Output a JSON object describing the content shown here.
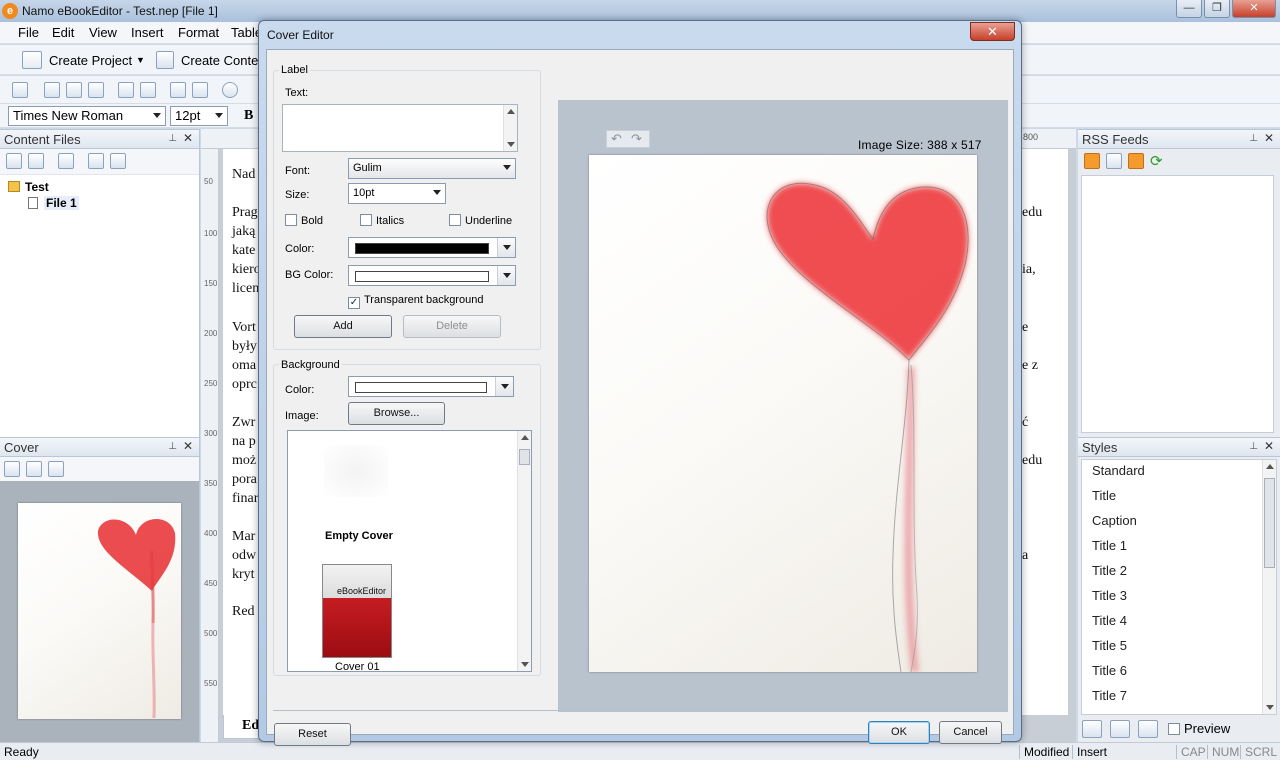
{
  "app": {
    "title": "Namo eBookEditor - Test.nep [File 1]",
    "icon_letter": "e",
    "window_buttons": [
      "—",
      "❐",
      "✕"
    ]
  },
  "menu": [
    "File",
    "Edit",
    "View",
    "Insert",
    "Format",
    "Table"
  ],
  "toolbar": {
    "create_project": "Create Project",
    "create_content": "Create Conter"
  },
  "format_bar": {
    "font": "Times New Roman",
    "size": "12pt",
    "bold": "B"
  },
  "content_files": {
    "title": "Content Files",
    "tree": [
      {
        "label": "Test",
        "type": "folder"
      },
      {
        "label": "File 1",
        "type": "file"
      }
    ]
  },
  "cover_panel": {
    "title": "Cover"
  },
  "document": {
    "ruler_marks": [
      "50",
      "100",
      "150",
      "200",
      "250",
      "300",
      "350",
      "400",
      "450",
      "500",
      "550"
    ],
    "lines": [
      "Nad",
      "Prag",
      "jaką",
      "kate",
      "kiero",
      "licen",
      "Vort",
      "były",
      "oma",
      "oprc",
      "Zwr",
      "na p",
      "moż",
      "pora",
      "finar",
      "Mar",
      "odw",
      "kryt",
      "Red"
    ],
    "right_fragments": [
      "edu",
      "ia,",
      "e",
      "e z",
      "ć",
      "edu",
      "a"
    ],
    "ruler_right": "800",
    "tab": "Ed"
  },
  "rss": {
    "title": "RSS Feeds"
  },
  "styles": {
    "title": "Styles",
    "items": [
      "Standard",
      "Title",
      "Caption",
      "Title 1",
      "Title 2",
      "Title 3",
      "Title 4",
      "Title 5",
      "Title 6",
      "Title 7"
    ],
    "preview_label": "Preview"
  },
  "status": {
    "left": "Ready",
    "cells": [
      "Modified",
      "Insert",
      "CAP",
      "NUM",
      "SCRL"
    ]
  },
  "dialog": {
    "title": "Cover Editor",
    "close": "✕",
    "label_group": {
      "title": "Label",
      "text_label": "Text:",
      "text_value": "",
      "font_label": "Font:",
      "font_value": "Gulim",
      "size_label": "Size:",
      "size_value": "10pt",
      "bold": "Bold",
      "italics": "Italics",
      "underline": "Underline",
      "color_label": "Color:",
      "color_value": "#000000",
      "bgcolor_label": "BG Color:",
      "bgcolor_value": "#ffffff",
      "transparent": "Transparent background",
      "transparent_checked": true,
      "add": "Add",
      "delete": "Delete"
    },
    "background_group": {
      "title": "Background",
      "color_label": "Color:",
      "color_value": "#ffffff",
      "image_label": "Image:",
      "browse": "Browse...",
      "covers": [
        {
          "name": "Empty Cover"
        },
        {
          "name": "Cover 01",
          "thumb_text": "eBookEditor"
        }
      ]
    },
    "image_size": "Image Size: 388 x 517",
    "reset": "Reset",
    "ok": "OK",
    "cancel": "Cancel"
  }
}
